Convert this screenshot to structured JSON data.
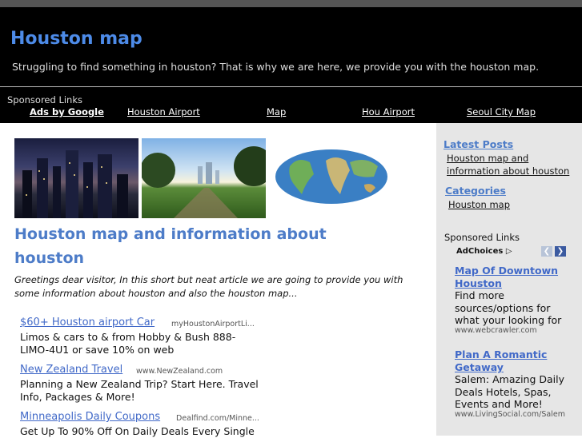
{
  "site": {
    "title": "Houston map",
    "tagline": "Struggling to find something in houston? That is why we are here, we provide you with the houston map."
  },
  "nav": {
    "sponsored_label": "Sponsored Links",
    "ads_by": "Ads by Google",
    "links": [
      "Houston Airport",
      "Map",
      "Hou Airport",
      "Seoul City Map"
    ]
  },
  "post": {
    "title": "Houston map and information about houston",
    "intro": "Greetings dear visitor, In this short but neat article we are going to provide you with some information about houston and also the houston map..."
  },
  "images": [
    "houston-skyline-night-photo",
    "houston-park-skyline-photo",
    "world-map-image"
  ],
  "ads": [
    {
      "title": "$60+ Houston airport Car",
      "url": "myHoustonAirportLi...",
      "desc": "Limos & cars to & from Hobby & Bush 888-LIMO-4U1 or save 10% on web"
    },
    {
      "title": "New Zealand Travel",
      "url": "www.NewZealand.com",
      "desc": "Planning a New Zealand Trip? Start Here. Travel Info, Packages & More!"
    },
    {
      "title": "Minneapolis Daily Coupons",
      "url": "Dealfind.com/Minne...",
      "desc": "Get Up To 90% Off On Daily Deals Every Single"
    }
  ],
  "sidebar": {
    "latest_posts_heading": "Latest Posts",
    "latest_post": "Houston map and information about houston",
    "categories_heading": "Categories",
    "category": "Houston map",
    "sponsored_label": "Sponsored Links",
    "adchoices": "AdChoices",
    "ads": [
      {
        "title": "Map Of Downtown Houston",
        "desc": "Find more sources/options for what your looking for",
        "url": "www.webcrawler.com"
      },
      {
        "title": "Plan A Romantic Getaway",
        "desc": "Salem: Amazing Daily Deals Hotels, Spas, Events and More!",
        "url": "www.LivingSocial.com/Salem"
      }
    ]
  },
  "colors": {
    "title_blue": "#4d8be8",
    "link_blue": "#4169c8",
    "header_bg": "#000000",
    "sidebar_bg": "#e6e6e6"
  }
}
